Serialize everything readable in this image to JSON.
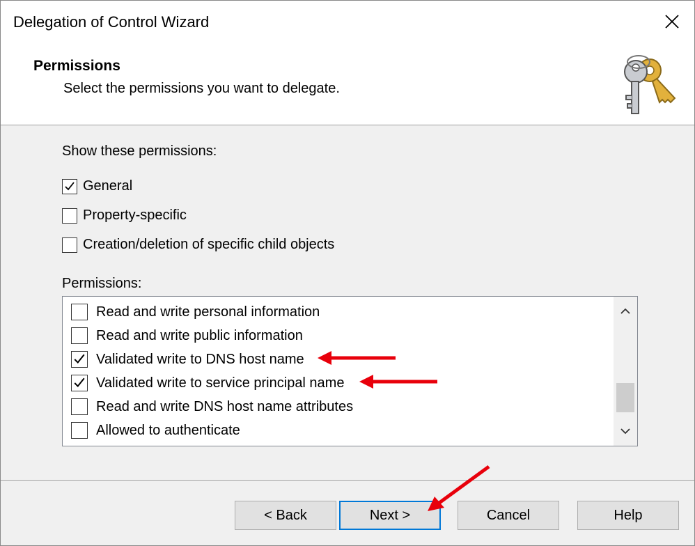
{
  "window": {
    "title": "Delegation of Control Wizard"
  },
  "header": {
    "title": "Permissions",
    "subtitle": "Select the permissions you want to delegate."
  },
  "show_section": {
    "label": "Show these permissions:",
    "options": [
      {
        "label": "General",
        "checked": true
      },
      {
        "label": "Property-specific",
        "checked": false
      },
      {
        "label": "Creation/deletion of specific child objects",
        "checked": false
      }
    ]
  },
  "permissions": {
    "label": "Permissions:",
    "items": [
      {
        "label": "Read and write personal information",
        "checked": false
      },
      {
        "label": "Read and write public information",
        "checked": false
      },
      {
        "label": "Validated write to DNS host name",
        "checked": true
      },
      {
        "label": "Validated write to service principal name",
        "checked": true
      },
      {
        "label": "Read and write DNS host name attributes",
        "checked": false
      },
      {
        "label": "Allowed to authenticate",
        "checked": false
      }
    ]
  },
  "buttons": {
    "back": "< Back",
    "next": "Next >",
    "cancel": "Cancel",
    "help": "Help"
  },
  "icons": {
    "close": "close-icon",
    "keys": "keys-icon",
    "scroll_up": "chevron-up-icon",
    "scroll_down": "chevron-down-icon"
  },
  "colors": {
    "annotation_arrow": "#e8000b",
    "default_button_border": "#0078d7"
  }
}
